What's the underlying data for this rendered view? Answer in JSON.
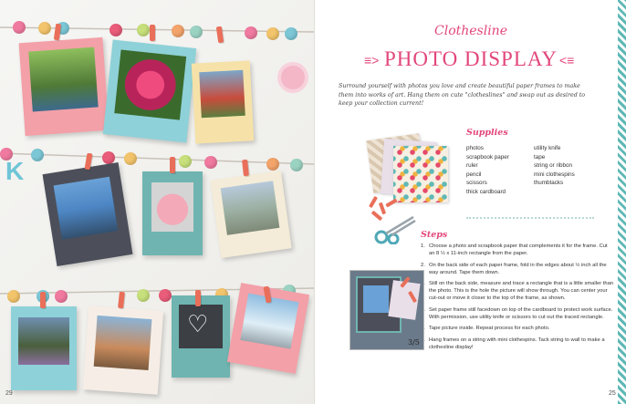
{
  "left_page": {
    "page_number": "29"
  },
  "right_page": {
    "page_number": "25",
    "title_script": "Clothesline",
    "title_main": "PHOTO DISPLAY",
    "intro": "Surround yourself with photos you love and create beautiful paper frames to make them into works of art. Hang them on cute \"clotheslines\" and swap out as desired to keep your collection current!",
    "supplies_heading": "Supplies",
    "supplies_left": [
      "photos",
      "scrapbook paper",
      "ruler",
      "pencil",
      "scissors",
      "thick cardboard"
    ],
    "supplies_right": [
      "utility knife",
      "tape",
      "string or ribbon",
      "mini clothespins",
      "thumbtacks"
    ],
    "steps_heading": "Steps",
    "steps": [
      {
        "n": "1.",
        "text": "Choose a photo and scrapbook paper that complements it for the frame. Cut an 8 ½ x 11-inch rectangle from the paper."
      },
      {
        "n": "2.",
        "text": "On the back side of each paper frame, fold in the edges about ½ inch all the way around. Tape them down."
      },
      {
        "n": "3.",
        "text": "Still on the back side, measure and trace a rectangle that is a little smaller than the photo. This is the hole the picture will show through. You can center your cut-out or move it closer to the top of the frame, as shown."
      },
      {
        "n": "4.",
        "text": "Set paper frame still facedown on top of the cardboard to protect work surface. With permission, use utility knife or scissors to cut out the traced rectangle."
      },
      {
        "n": "5.",
        "text": "Tape picture inside. Repeat process for each photo."
      },
      {
        "n": "6.",
        "text": "Hang frames on a string with mini clothespins. Tack string to wall to make a clothesline display!"
      }
    ],
    "step_photo_label": "3/5"
  },
  "colors": {
    "accent": "#e2467a",
    "teal": "#5fb8b5",
    "clothespin": "#e96f5a"
  }
}
